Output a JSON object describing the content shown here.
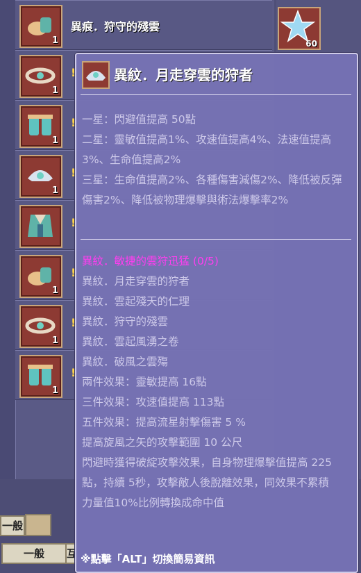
{
  "list": {
    "items": [
      {
        "name": "異痕．狩守的殘雲",
        "qty": "1",
        "icon": "boots-icon"
      },
      {
        "name": "",
        "mark": "!",
        "qty": "1",
        "icon": "belt-icon"
      },
      {
        "name": "",
        "mark": "!",
        "qty": "1",
        "icon": "gloves-icon"
      },
      {
        "name": "",
        "mark": "!",
        "qty": "1",
        "icon": "helmet-icon"
      },
      {
        "name": "",
        "mark": "!",
        "qty": "",
        "icon": "armor-icon"
      },
      {
        "name": "",
        "mark": "!",
        "qty": "1",
        "icon": "boots-icon"
      },
      {
        "name": "",
        "mark": "!",
        "qty": "1",
        "icon": "belt-icon"
      },
      {
        "name": "",
        "mark": "!",
        "qty": "1",
        "icon": "gloves-icon"
      }
    ],
    "right_slot": {
      "qty": "60",
      "icon": "star-icon"
    }
  },
  "bottom": {
    "btn_general_1": "一般",
    "btn_general_2": "一般",
    "btn_edge": "互"
  },
  "tooltip": {
    "title": "異紋．月走穿雲的狩者",
    "stats": [
      "一星：閃避值提高 50點",
      "二星：靈敏值提高1%、攻速值提高4%、法速值提高3%、生命值提高2%",
      "三星：生命值提高2%、各種傷害減傷2%、降低被反彈傷害2%、降低被物理爆擊與術法爆擊率2%"
    ],
    "set_title": "異紋．敏捷的雲狩迅猛 (0/5)",
    "set_items": [
      "異紋．月走穿雲的狩者",
      "異紋．雲起殘天的仁理",
      "異紋．狩守的殘雲",
      "異紋．雲起風湧之卷",
      "異紋．破風之雲殤"
    ],
    "set_effects": [
      "兩件效果：靈敏提高 16點",
      "三件效果：攻速值提高 113點",
      "五件效果：提高流星射擊傷害 5 %",
      "提高旋風之矢的攻擊範圍 10 公尺",
      "閃避時獲得破綻攻擊效果，自身物理爆擊值提高 225點，持續 5秒，攻擊敵人後脫離效果，同效果不累積",
      "力量值10%比例轉換成命中值"
    ],
    "footer": "※點擊「ALT」切換簡易資訊"
  },
  "colors": {
    "set_title": "#ff3df0",
    "text": "#cdc9e9",
    "slot_bg": "#8d3a33",
    "slot_border": "#c9a57a"
  }
}
